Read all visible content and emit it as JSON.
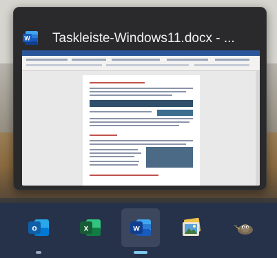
{
  "flyout": {
    "title": "Taskleiste-Windows11.docx - ...",
    "app_icon": "word-icon"
  },
  "taskbar": {
    "items": [
      {
        "name": "outlook",
        "icon": "outlook-icon",
        "letter": "o",
        "color": "#0f6cbd",
        "running": true,
        "active": false
      },
      {
        "name": "excel",
        "icon": "excel-icon",
        "letter": "x",
        "color": "#1e7145",
        "running": false,
        "active": false
      },
      {
        "name": "word",
        "icon": "word-icon",
        "letter": "w",
        "color": "#2b579a",
        "running": true,
        "active": true
      },
      {
        "name": "photos",
        "icon": "photos-icon",
        "letter": "",
        "color": "#d9822b",
        "running": false,
        "active": false
      },
      {
        "name": "gimp",
        "icon": "gimp-icon",
        "letter": "",
        "color": "#6b5a43",
        "running": false,
        "active": false
      }
    ]
  },
  "colors": {
    "taskbar_bg": "#26324a",
    "flyout_bg": "#2a2a2c",
    "active_indicator": "#7fc8f0",
    "word_blue": "#2b579a"
  }
}
